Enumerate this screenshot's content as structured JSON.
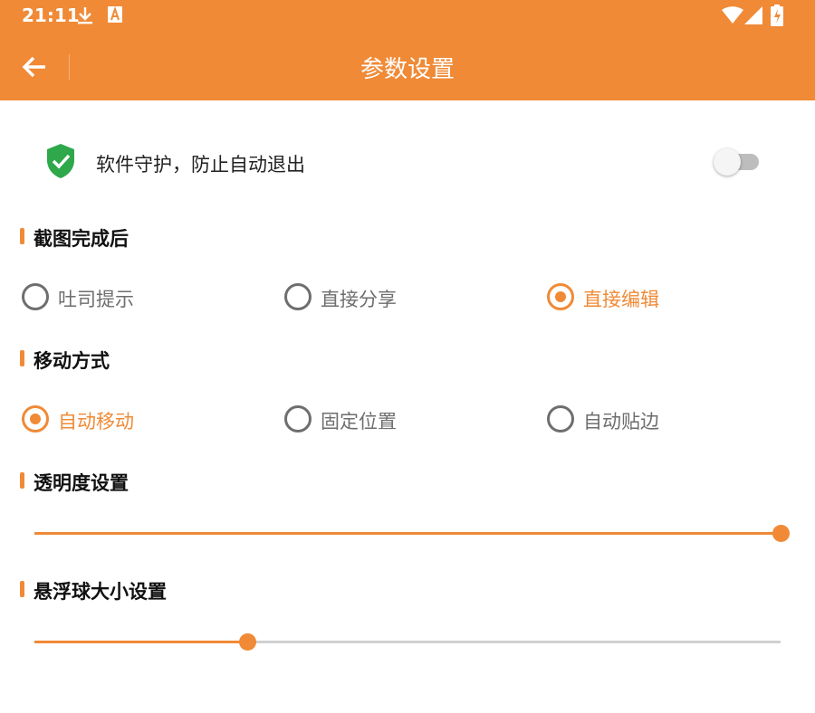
{
  "theme": {
    "accent": "#F08A36",
    "shield_color": "#2EA84A"
  },
  "status_bar": {
    "time": "21:11",
    "icons": [
      "download-icon",
      "font-a-icon",
      "wifi-icon",
      "signal-icon",
      "battery-charging-icon"
    ]
  },
  "toolbar": {
    "title": "参数设置",
    "back_icon": "arrow-back-icon"
  },
  "protect": {
    "label": "软件守护，防止自动退出",
    "enabled": false
  },
  "sections": {
    "screenshot": {
      "title": "截图完成后",
      "options": [
        {
          "label": "吐司提示",
          "checked": false
        },
        {
          "label": "直接分享",
          "checked": false
        },
        {
          "label": "直接编辑",
          "checked": true
        }
      ]
    },
    "move": {
      "title": "移动方式",
      "options": [
        {
          "label": "自动移动",
          "checked": true
        },
        {
          "label": "固定位置",
          "checked": false
        },
        {
          "label": "自动贴边",
          "checked": false
        }
      ]
    },
    "opacity": {
      "title": "透明度设置",
      "value": 1.0
    },
    "ball_size": {
      "title": "悬浮球大小设置",
      "value": 0.285
    }
  }
}
